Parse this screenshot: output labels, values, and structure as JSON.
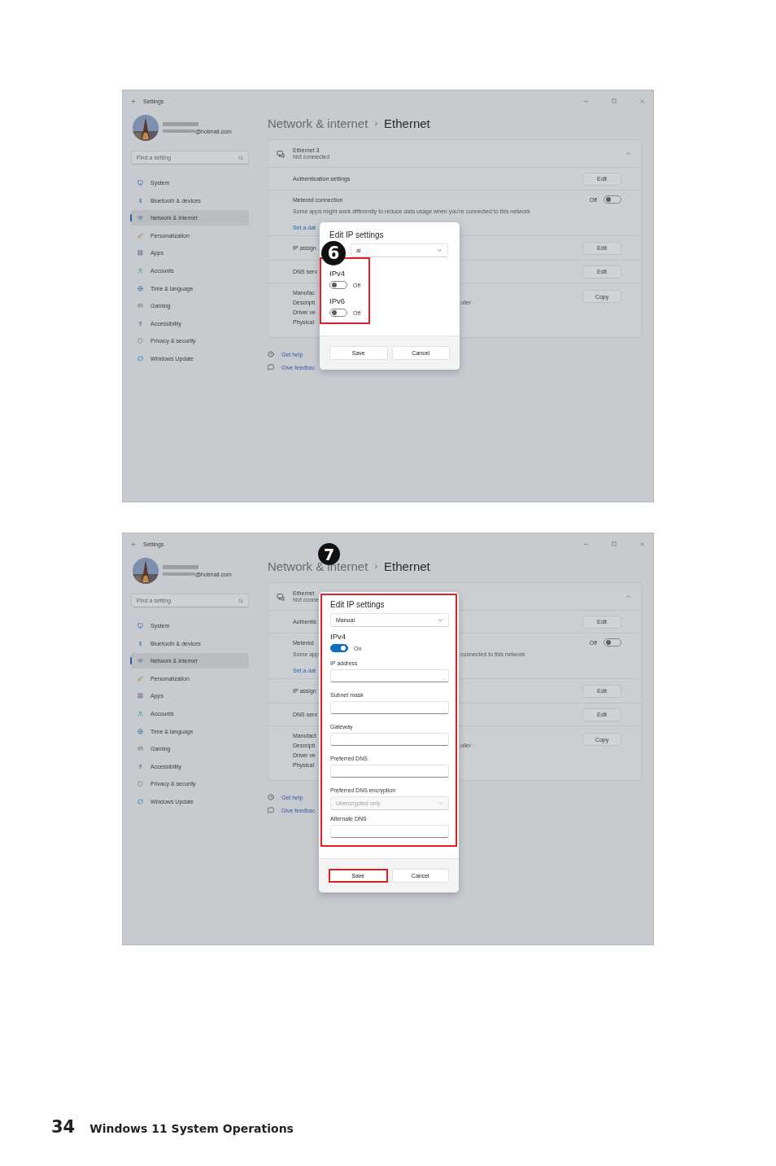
{
  "figures": [
    {
      "step": "6",
      "window": {
        "app_title": "Settings",
        "account": {
          "email": "@hotmail.com"
        },
        "search": {
          "placeholder": "Find a setting"
        },
        "nav": [
          {
            "label": "System",
            "selected": false
          },
          {
            "label": "Bluetooth & devices",
            "selected": false
          },
          {
            "label": "Network & internet",
            "selected": true
          },
          {
            "label": "Personalization",
            "selected": false
          },
          {
            "label": "Apps",
            "selected": false
          },
          {
            "label": "Accounts",
            "selected": false
          },
          {
            "label": "Time & language",
            "selected": false
          },
          {
            "label": "Gaming",
            "selected": false
          },
          {
            "label": "Accessibility",
            "selected": false
          },
          {
            "label": "Privacy & security",
            "selected": false
          },
          {
            "label": "Windows Update",
            "selected": false
          }
        ],
        "breadcrumb": {
          "parent": "Network & internet",
          "separator": "›",
          "current": "Ethernet"
        },
        "adapter": {
          "name": "Ethernet 3",
          "status": "Not connected",
          "expanded": true
        },
        "rows": [
          {
            "kind": "button",
            "label": "Authentication settings",
            "button": "Edit"
          },
          {
            "kind": "toggle",
            "label": "Metered connection",
            "description": "Some apps might work differently to reduce data usage when you're connected to this network",
            "toggle_label": "Off",
            "on": false,
            "link": "Set a dat"
          },
          {
            "kind": "button",
            "label": "IP assign",
            "button": "Edit"
          },
          {
            "kind": "button",
            "label": "DNS serv",
            "button": "Edit"
          },
          {
            "kind": "properties",
            "lines": [
              {
                "label": "Manufac"
              },
              {
                "label": "Descripti",
                "tail": "oller"
              },
              {
                "label": "Driver ve"
              },
              {
                "label": "Physical"
              }
            ],
            "button": "Copy"
          }
        ],
        "links": [
          "Get help",
          "Give feedbac"
        ]
      },
      "dialog": {
        "items": [
          {
            "kind": "title",
            "label": "Edit IP settings"
          },
          {
            "kind": "select",
            "value": "al",
            "disabled": false
          }
        ],
        "highlight": {
          "items": [
            {
              "kind": "heading",
              "label": "IPv4"
            },
            {
              "kind": "toggle",
              "on": false,
              "label": "Off"
            },
            {
              "kind": "heading",
              "label": "IPv6"
            },
            {
              "kind": "toggle",
              "on": false,
              "label": "Off"
            }
          ]
        },
        "buttons": [
          {
            "label": "Save",
            "highlighted": false
          },
          {
            "label": "Cancel",
            "highlighted": false
          }
        ]
      }
    },
    {
      "step": "7",
      "window": {
        "app_title": "Settings",
        "account": {
          "email": "@hotmail.com"
        },
        "search": {
          "placeholder": "Find a setting"
        },
        "nav": [
          {
            "label": "System",
            "selected": false
          },
          {
            "label": "Bluetooth & devices",
            "selected": false
          },
          {
            "label": "Network & internet",
            "selected": true
          },
          {
            "label": "Personalization",
            "selected": false
          },
          {
            "label": "Apps",
            "selected": false
          },
          {
            "label": "Accounts",
            "selected": false
          },
          {
            "label": "Time & language",
            "selected": false
          },
          {
            "label": "Gaming",
            "selected": false
          },
          {
            "label": "Accessibility",
            "selected": false
          },
          {
            "label": "Privacy & security",
            "selected": false
          },
          {
            "label": "Windows Update",
            "selected": false
          }
        ],
        "breadcrumb": {
          "parent": "Network & internet",
          "separator": "›",
          "current": "Ethernet"
        },
        "adapter": {
          "name": "Ethernet",
          "status": "Not conne",
          "expanded": true
        },
        "rows": [
          {
            "kind": "button",
            "label": "Authentic",
            "button": "Edit"
          },
          {
            "kind": "toggle",
            "label": "Metered",
            "description": "Some app",
            "description_tail": "connected to this network",
            "toggle_label": "Off",
            "on": false,
            "link": "Set a dat"
          },
          {
            "kind": "button",
            "label": "IP assign",
            "button": "Edit"
          },
          {
            "kind": "button",
            "label": "DNS serv",
            "button": "Edit"
          },
          {
            "kind": "properties",
            "lines": [
              {
                "label": "Manufact"
              },
              {
                "label": "Descripti",
                "tail": "oller"
              },
              {
                "label": "Driver ve"
              },
              {
                "label": "Physical"
              }
            ],
            "button": "Copy"
          }
        ],
        "links": [
          "Get help",
          "Give feedbac"
        ]
      },
      "dialog": {
        "highlight": {
          "items": [
            {
              "kind": "title",
              "label": "Edit IP settings"
            },
            {
              "kind": "select",
              "value": "Manual",
              "disabled": false
            },
            {
              "kind": "heading",
              "label": "IPv4"
            },
            {
              "kind": "toggle",
              "on": true,
              "label": "On"
            },
            {
              "kind": "field",
              "label": "IP address"
            },
            {
              "kind": "field",
              "label": "Subnet mask"
            },
            {
              "kind": "field",
              "label": "Gateway"
            },
            {
              "kind": "field",
              "label": "Preferred DNS"
            },
            {
              "kind": "select",
              "label": "Preferred DNS encryption",
              "value": "Unencrypted only",
              "disabled": true
            },
            {
              "kind": "field",
              "label": "Alternate DNS"
            }
          ]
        },
        "buttons": [
          {
            "label": "Save",
            "highlighted": true
          },
          {
            "label": "Cancel",
            "highlighted": false
          }
        ]
      }
    }
  ],
  "footer": {
    "page_number": "34",
    "section": "Windows 11 System Operations"
  }
}
